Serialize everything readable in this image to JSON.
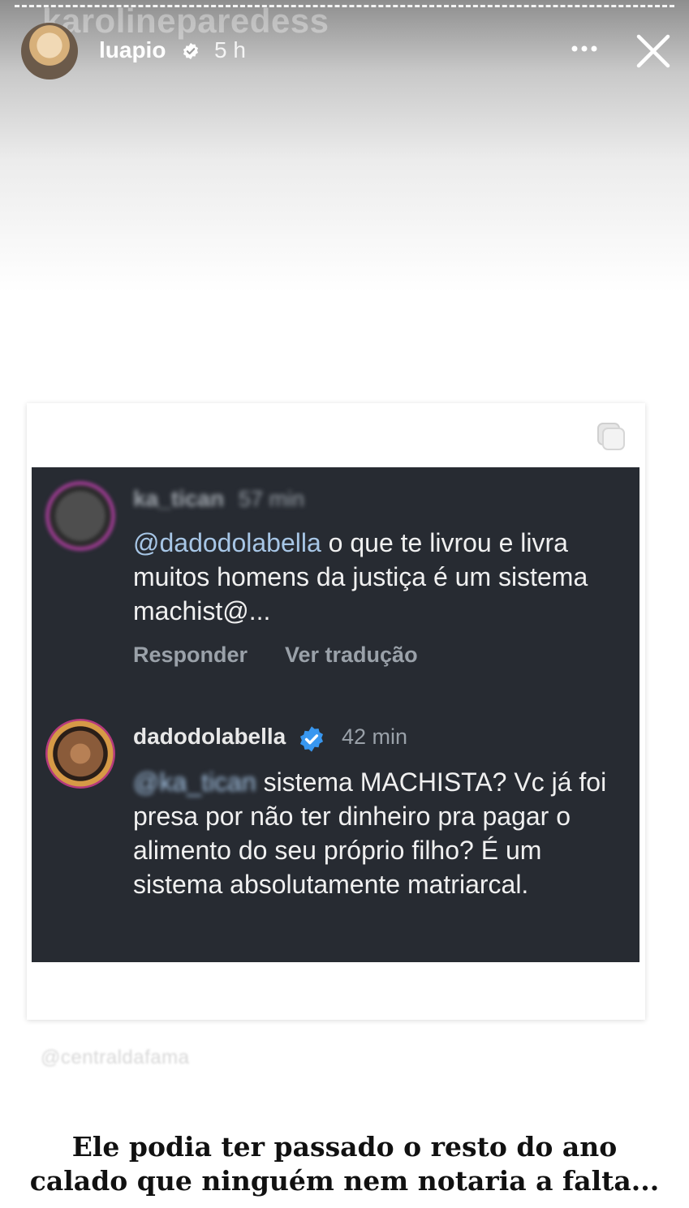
{
  "story": {
    "ghost_username": "karolineparedess",
    "username": "luapio",
    "time_ago": "5 h"
  },
  "post": {
    "comment1": {
      "username": "ka_tican",
      "time": "57 min",
      "mention": "@dadodolabella",
      "text": "o que te livrou e livra muitos homens da justiça é um sistema machist@...",
      "reply_label": "Responder",
      "translate_label": "Ver tradução"
    },
    "comment2": {
      "username": "dadodolabella",
      "time": "42 min",
      "mention": "@ka_tican",
      "text": "sistema MACHISTA? Vc já foi presa por não ter dinheiro pra pagar o alimento do seu próprio filho? É um sistema absolutamente matriarcal."
    }
  },
  "watermark": "@centraldafama",
  "caption": {
    "line1": "Ele podia ter passado o resto do ano",
    "line2": "calado que ninguém nem notaria a falta..."
  },
  "icons": [
    "verified-icon",
    "more-icon",
    "close-icon",
    "copy-icon"
  ],
  "colors": {
    "panel_bg": "#272b32",
    "mention": "#a7c6e6",
    "verified_blue": "#3897f0"
  }
}
